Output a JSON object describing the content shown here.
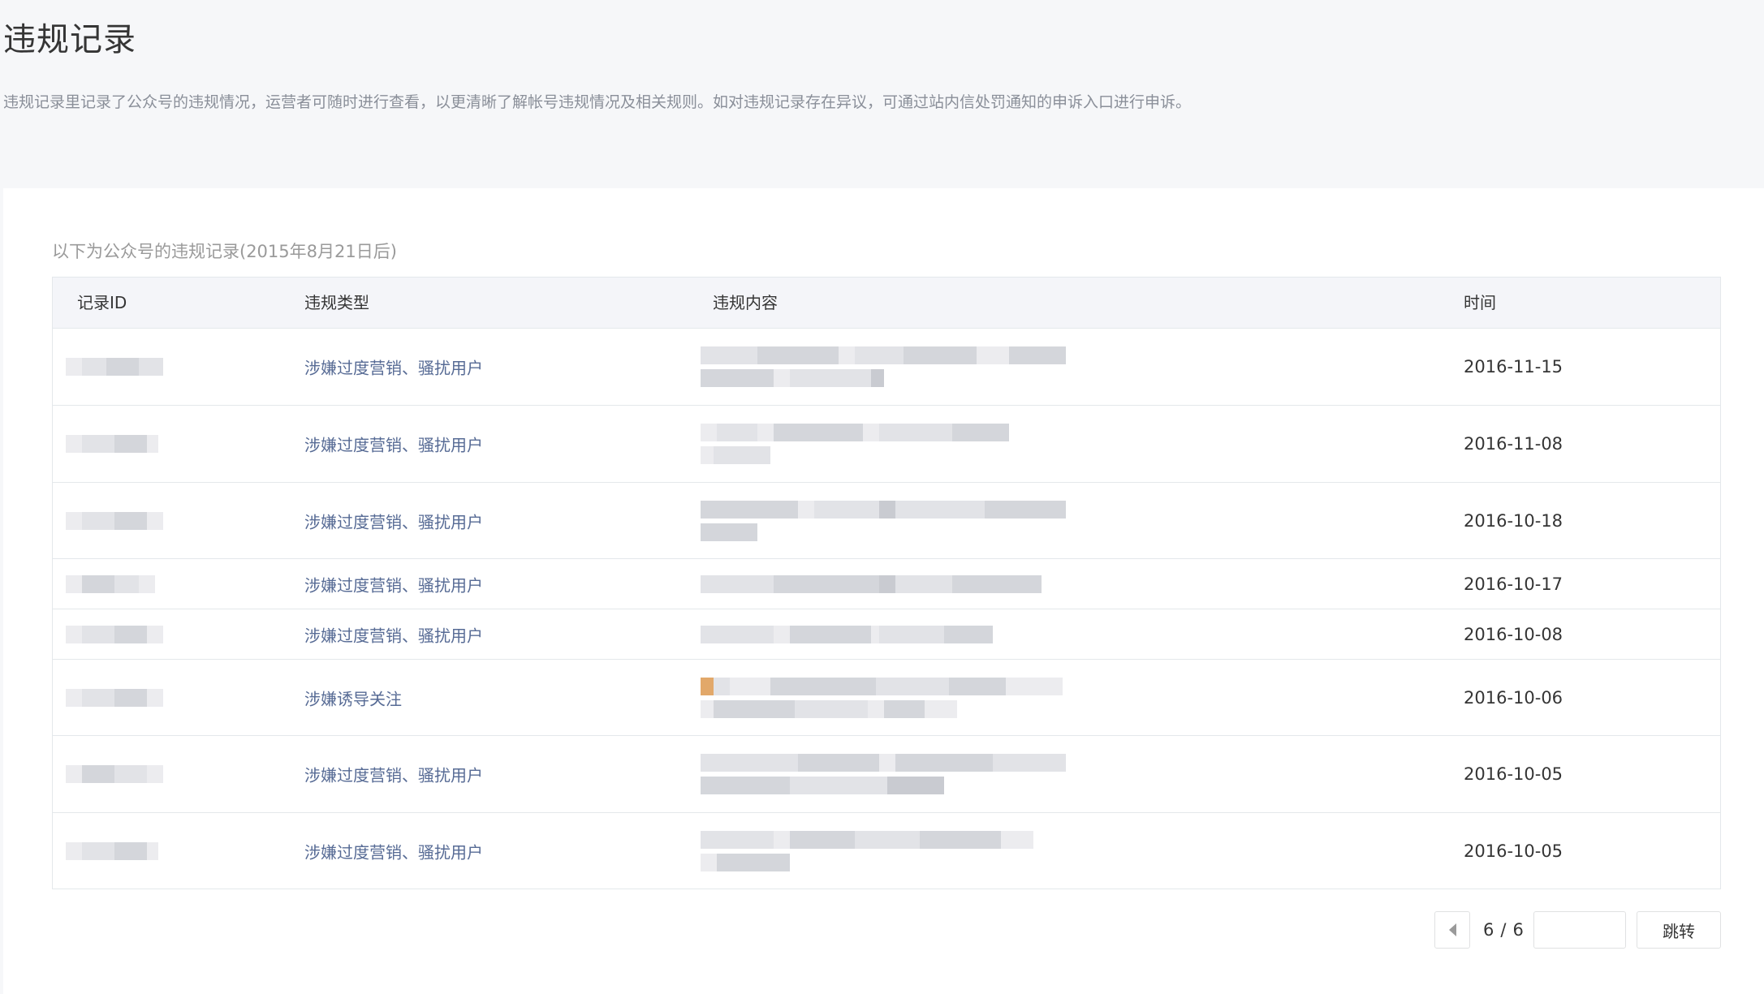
{
  "page": {
    "title": "违规记录",
    "description": "违规记录里记录了公众号的违规情况，运营者可随时进行查看，以更清晰了解帐号违规情况及相关规则。如对违规记录存在异议，可通过站内信处罚通知的申诉入口进行申诉。"
  },
  "panel": {
    "subtitle": "以下为公众号的违规记录(2015年8月21日后)"
  },
  "table": {
    "columns": [
      "记录ID",
      "违规类型",
      "违规内容",
      "时间"
    ],
    "rows": [
      {
        "type": "涉嫌过度营销、骚扰用户",
        "time": "2016-11-15"
      },
      {
        "type": "涉嫌过度营销、骚扰用户",
        "time": "2016-11-08"
      },
      {
        "type": "涉嫌过度营销、骚扰用户",
        "time": "2016-10-18"
      },
      {
        "type": "涉嫌过度营销、骚扰用户",
        "time": "2016-10-17"
      },
      {
        "type": "涉嫌过度营销、骚扰用户",
        "time": "2016-10-08"
      },
      {
        "type": "涉嫌诱导关注",
        "time": "2016-10-06"
      },
      {
        "type": "涉嫌过度营销、骚扰用户",
        "time": "2016-10-05"
      },
      {
        "type": "涉嫌过度营销、骚扰用户",
        "time": "2016-10-05"
      }
    ]
  },
  "pager": {
    "current": "6",
    "separator": "/",
    "total": "6",
    "jump_value": "",
    "jump_label": "跳转"
  },
  "colors": {
    "link": "#576b95",
    "header_bg": "#f4f5f9",
    "border": "#e4e8eb"
  },
  "icons": {
    "prev_page": "triangle-left-icon"
  }
}
